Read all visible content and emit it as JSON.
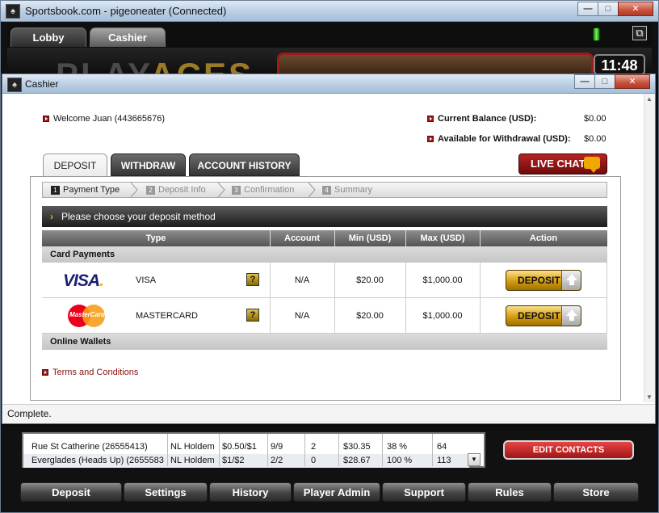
{
  "main_window": {
    "title": "Sportsbook.com - pigeoneater (Connected)",
    "icon_glyph": "♠",
    "min_glyph": "—",
    "max_glyph": "□",
    "close_glyph": "✕"
  },
  "nav": {
    "tabs": [
      {
        "label": "Lobby"
      },
      {
        "label": "Cashier"
      }
    ],
    "fullscreen_glyph": "⧉"
  },
  "banner": {
    "logo_play": "PLAY",
    "logo_aces": "ACES",
    "clock": "11:48"
  },
  "cashier": {
    "title": "Cashier",
    "welcome": "Welcome Juan (443665676)",
    "current_balance_label": "Current Balance (USD):",
    "current_balance_value": "$0.00",
    "available_label": "Available for Withdrawal (USD):",
    "available_value": "$0.00",
    "live_chat_label": "LIVE CHAT",
    "tabs": [
      {
        "label": "DEPOSIT"
      },
      {
        "label": "WITHDRAW"
      },
      {
        "label": "ACCOUNT HISTORY"
      }
    ],
    "steps": [
      {
        "num": "1",
        "label": "Payment Type"
      },
      {
        "num": "2",
        "label": "Deposit Info"
      },
      {
        "num": "3",
        "label": "Confirmation"
      },
      {
        "num": "4",
        "label": "Summary"
      }
    ],
    "method_header": "Please choose your deposit method",
    "columns": [
      "Type",
      "Account",
      "Min (USD)",
      "Max (USD)",
      "Action"
    ],
    "section_card": "Card Payments",
    "section_wallets": "Online Wallets",
    "rows": [
      {
        "logo": "VISA",
        "name": "VISA",
        "help": "?",
        "account": "N/A",
        "min": "$20.00",
        "max": "$1,000.00",
        "action": "DEPOSIT"
      },
      {
        "logo": "MasterCard",
        "name": "MASTERCARD",
        "help": "?",
        "account": "N/A",
        "min": "$20.00",
        "max": "$1,000.00",
        "action": "DEPOSIT"
      }
    ],
    "terms": "Terms and Conditions",
    "status": "Complete."
  },
  "lobby_table": {
    "rows": [
      {
        "name": "Rue St Catherine (26555413)",
        "game": "NL Holdem",
        "stakes": "$0.50/$1",
        "seats": "9/9",
        "waiting": "2",
        "avg_pot": "$30.35",
        "flop": "38 %",
        "hands": "64"
      },
      {
        "name": "Everglades (Heads Up) (2655583",
        "game": "NL Holdem",
        "stakes": "$1/$2",
        "seats": "2/2",
        "waiting": "0",
        "avg_pot": "$28.67",
        "flop": "100 %",
        "hands": "113"
      }
    ],
    "scroll_glyph": "▼"
  },
  "edit_contacts_label": "EDIT CONTACTS",
  "bottom_nav": [
    {
      "label": "Deposit"
    },
    {
      "label": "Settings"
    },
    {
      "label": "History"
    },
    {
      "label": "Player Admin"
    },
    {
      "label": "Support"
    },
    {
      "label": "Rules"
    },
    {
      "label": "Store"
    }
  ]
}
